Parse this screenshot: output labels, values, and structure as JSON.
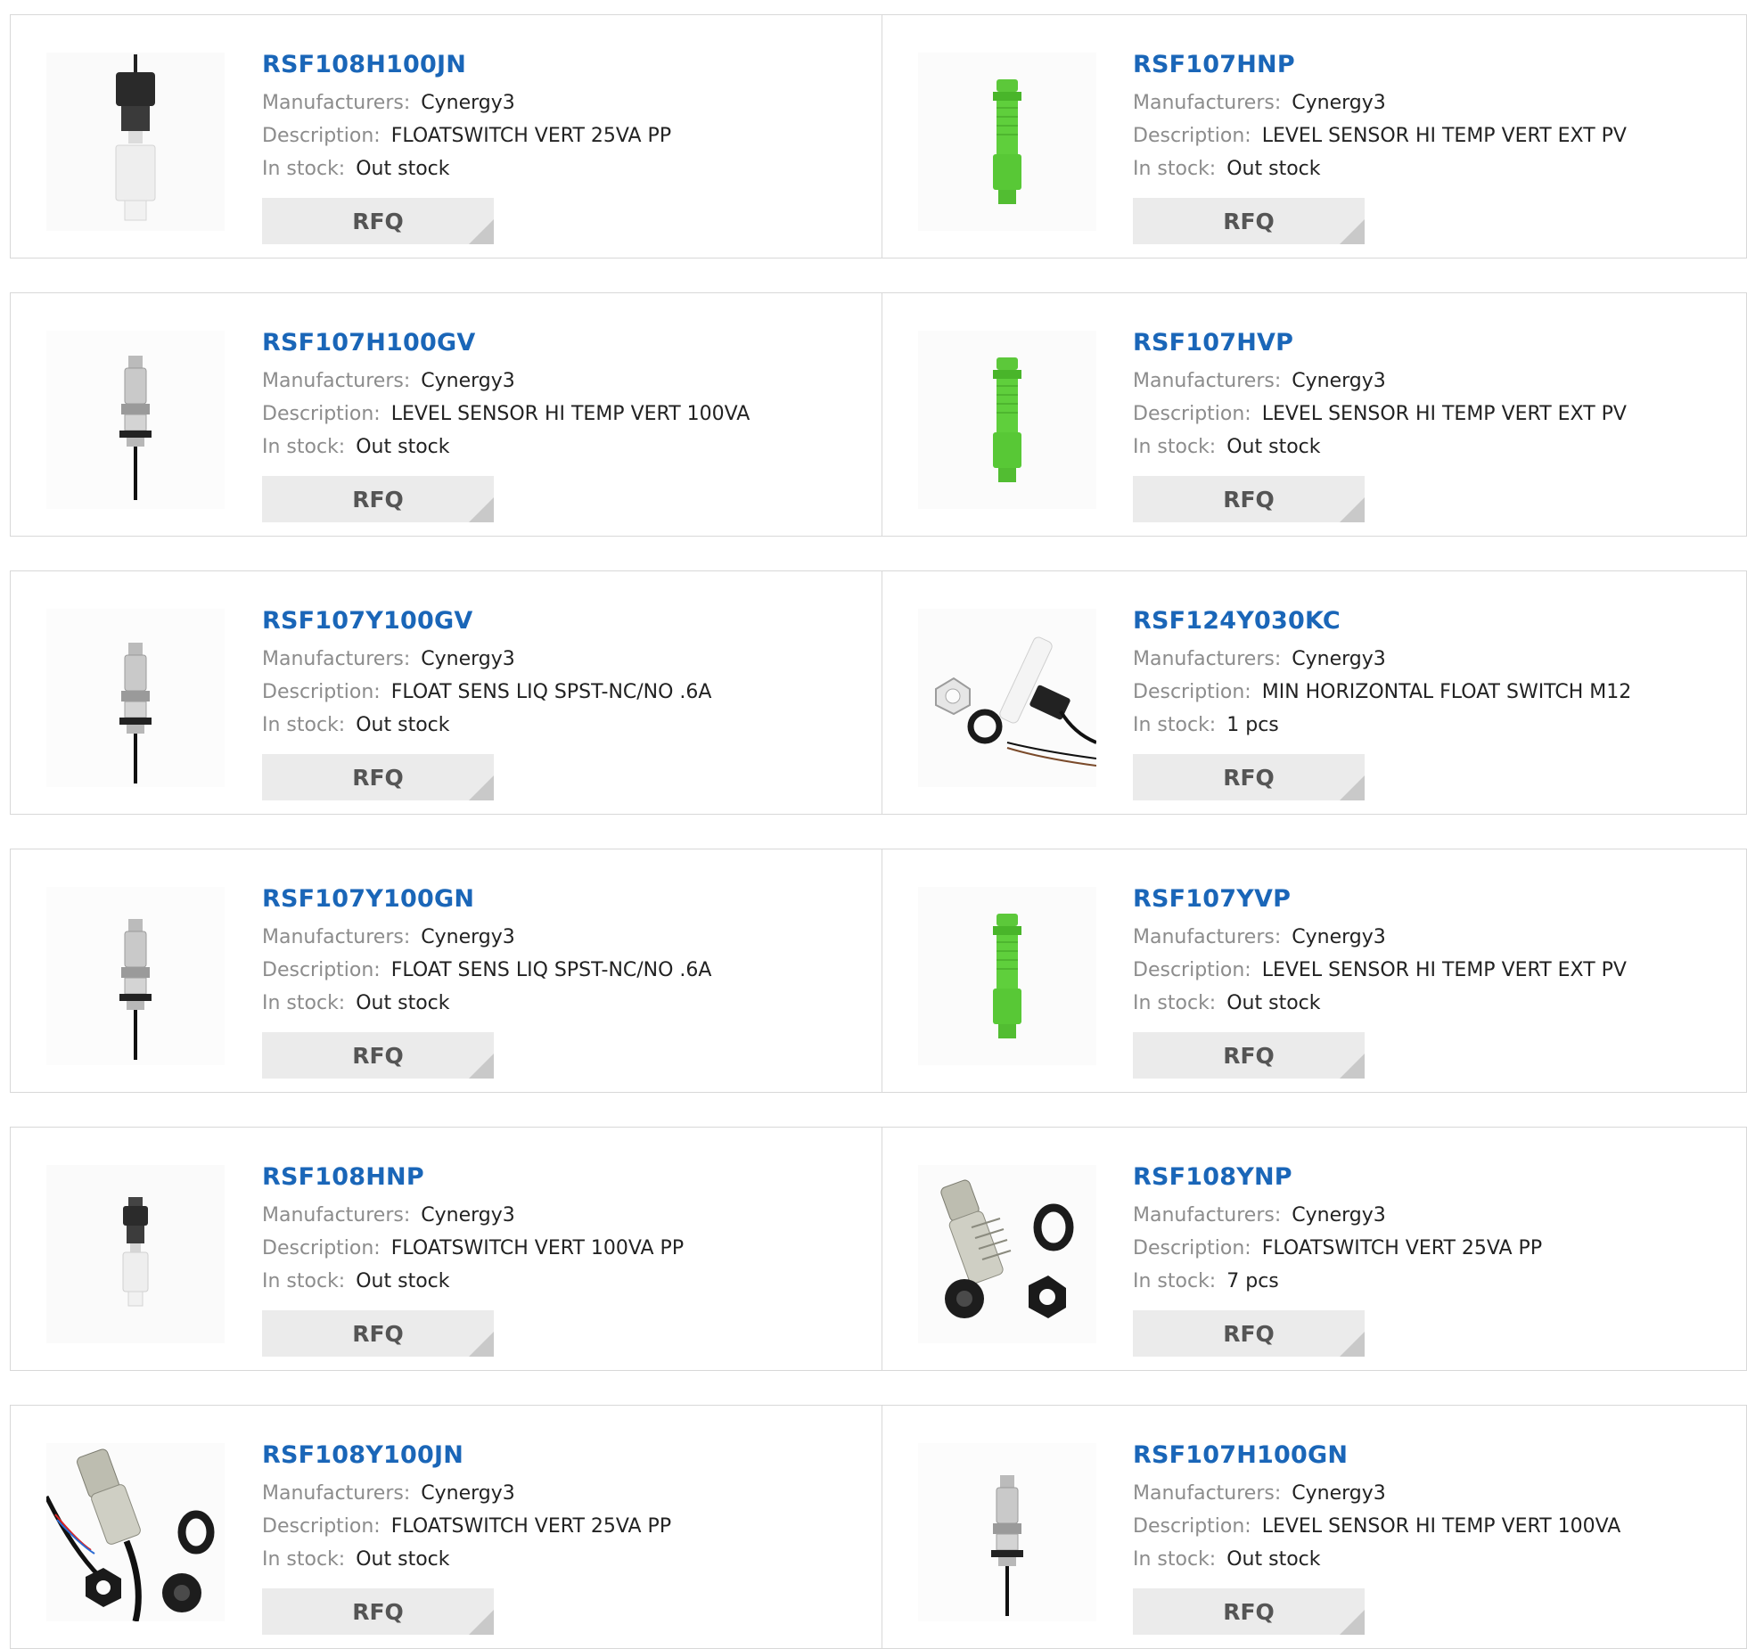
{
  "labels": {
    "manufacturers": "Manufacturers:",
    "description": "Description:",
    "in_stock": "In stock:",
    "rfq": "RFQ"
  },
  "products": [
    {
      "name": "RSF108H100JN",
      "manufacturer": "Cynergy3",
      "description": "FLOATSWITCH VERT 25VA PP",
      "stock": "Out stock",
      "image": "black-float-switch-image"
    },
    {
      "name": "RSF107HNP",
      "manufacturer": "Cynergy3",
      "description": "LEVEL SENSOR HI TEMP VERT EXT PV",
      "stock": "Out stock",
      "image": "green-level-sensor-image"
    },
    {
      "name": "RSF107H100GV",
      "manufacturer": "Cynergy3",
      "description": "LEVEL SENSOR HI TEMP VERT 100VA",
      "stock": "Out stock",
      "image": "grey-float-sensor-image"
    },
    {
      "name": "RSF107HVP",
      "manufacturer": "Cynergy3",
      "description": "LEVEL SENSOR HI TEMP VERT EXT PV",
      "stock": "Out stock",
      "image": "green-level-sensor-image"
    },
    {
      "name": "RSF107Y100GV",
      "manufacturer": "Cynergy3",
      "description": "FLOAT SENS LIQ SPST-NC/NO .6A",
      "stock": "Out stock",
      "image": "grey-float-sensor-image"
    },
    {
      "name": "RSF124Y030KC",
      "manufacturer": "Cynergy3",
      "description": "MIN HORIZONTAL FLOAT SWITCH M12",
      "stock": "1 pcs",
      "image": "horizontal-float-switch-image"
    },
    {
      "name": "RSF107Y100GN",
      "manufacturer": "Cynergy3",
      "description": "FLOAT SENS LIQ SPST-NC/NO .6A",
      "stock": "Out stock",
      "image": "grey-float-sensor-image"
    },
    {
      "name": "RSF107YVP",
      "manufacturer": "Cynergy3",
      "description": "LEVEL SENSOR HI TEMP VERT EXT PV",
      "stock": "Out stock",
      "image": "green-level-sensor-image"
    },
    {
      "name": "RSF108HNP",
      "manufacturer": "Cynergy3",
      "description": "FLOATSWITCH VERT 100VA PP",
      "stock": "Out stock",
      "image": "black-float-switch-image"
    },
    {
      "name": "RSF108YNP",
      "manufacturer": "Cynergy3",
      "description": "FLOATSWITCH VERT 25VA PP",
      "stock": "7 pcs",
      "image": "threaded-sensor-kit-image"
    },
    {
      "name": "RSF108Y100JN",
      "manufacturer": "Cynergy3",
      "description": "FLOATSWITCH VERT 25VA PP",
      "stock": "Out stock",
      "image": "cabled-sensor-kit-image"
    },
    {
      "name": "RSF107H100GN",
      "manufacturer": "Cynergy3",
      "description": "LEVEL SENSOR HI TEMP VERT 100VA",
      "stock": "Out stock",
      "image": "grey-float-sensor-image"
    }
  ]
}
